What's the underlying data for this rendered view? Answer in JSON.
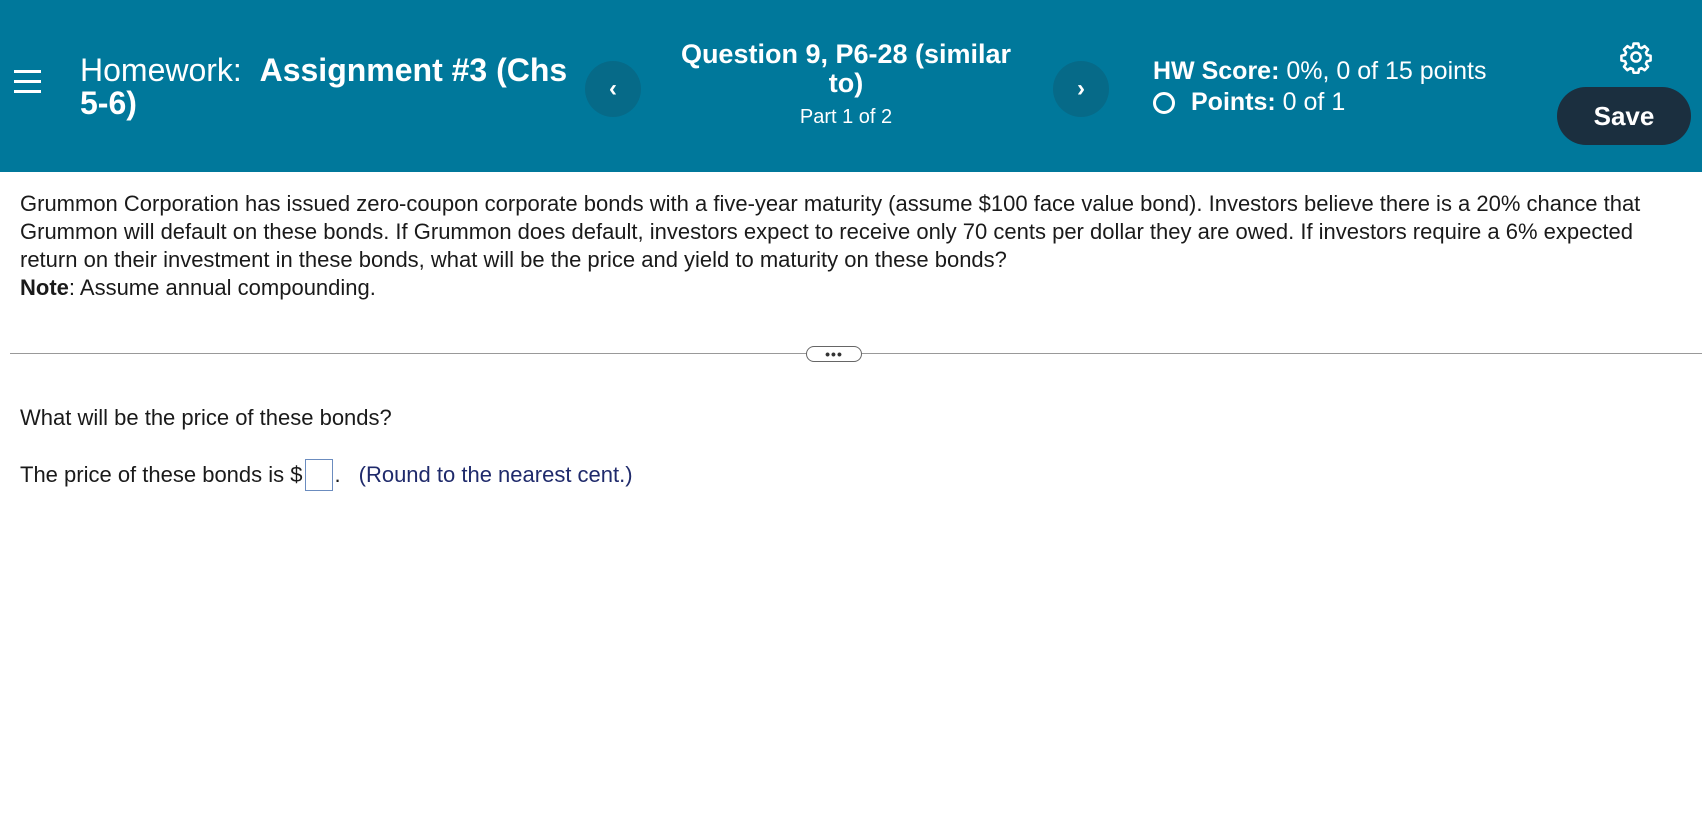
{
  "header": {
    "hw_prefix": "Homework:",
    "hw_name": "Assignment #3 (Chs 5-6)",
    "question_title": "Question 9, P6-28 (similar to)",
    "question_part": "Part 1 of 2",
    "prev_symbol": "‹",
    "next_symbol": "›",
    "hw_score_label": "HW Score:",
    "hw_score_value": "0%, 0 of 15 points",
    "points_label": "Points:",
    "points_value": "0 of 1",
    "save_label": "Save"
  },
  "problem": {
    "text": "Grummon Corporation has issued zero-coupon corporate bonds with a five-year maturity (assume $100 face value bond). Investors believe there is a 20%  chance that Grummon will default on these bonds. If Grummon does default, investors expect to receive only 70 cents per dollar they are owed. If investors require a 6% expected return on their investment in these bonds, what will be the price and yield to maturity on these bonds?",
    "note_label": "Note",
    "note_text": ": Assume annual compounding."
  },
  "expand_label": "•••",
  "part1": {
    "question": "What will be the price of these bonds?",
    "answer_prefix": "The price of these bonds is $",
    "answer_suffix": ".",
    "answer_value": "",
    "hint": "(Round to the nearest cent.)"
  },
  "colors": {
    "header_bg": "#00789b",
    "nav_btn_bg": "#066a88",
    "save_bg": "#1b2f3f",
    "hint_color": "#1f2a6b"
  }
}
